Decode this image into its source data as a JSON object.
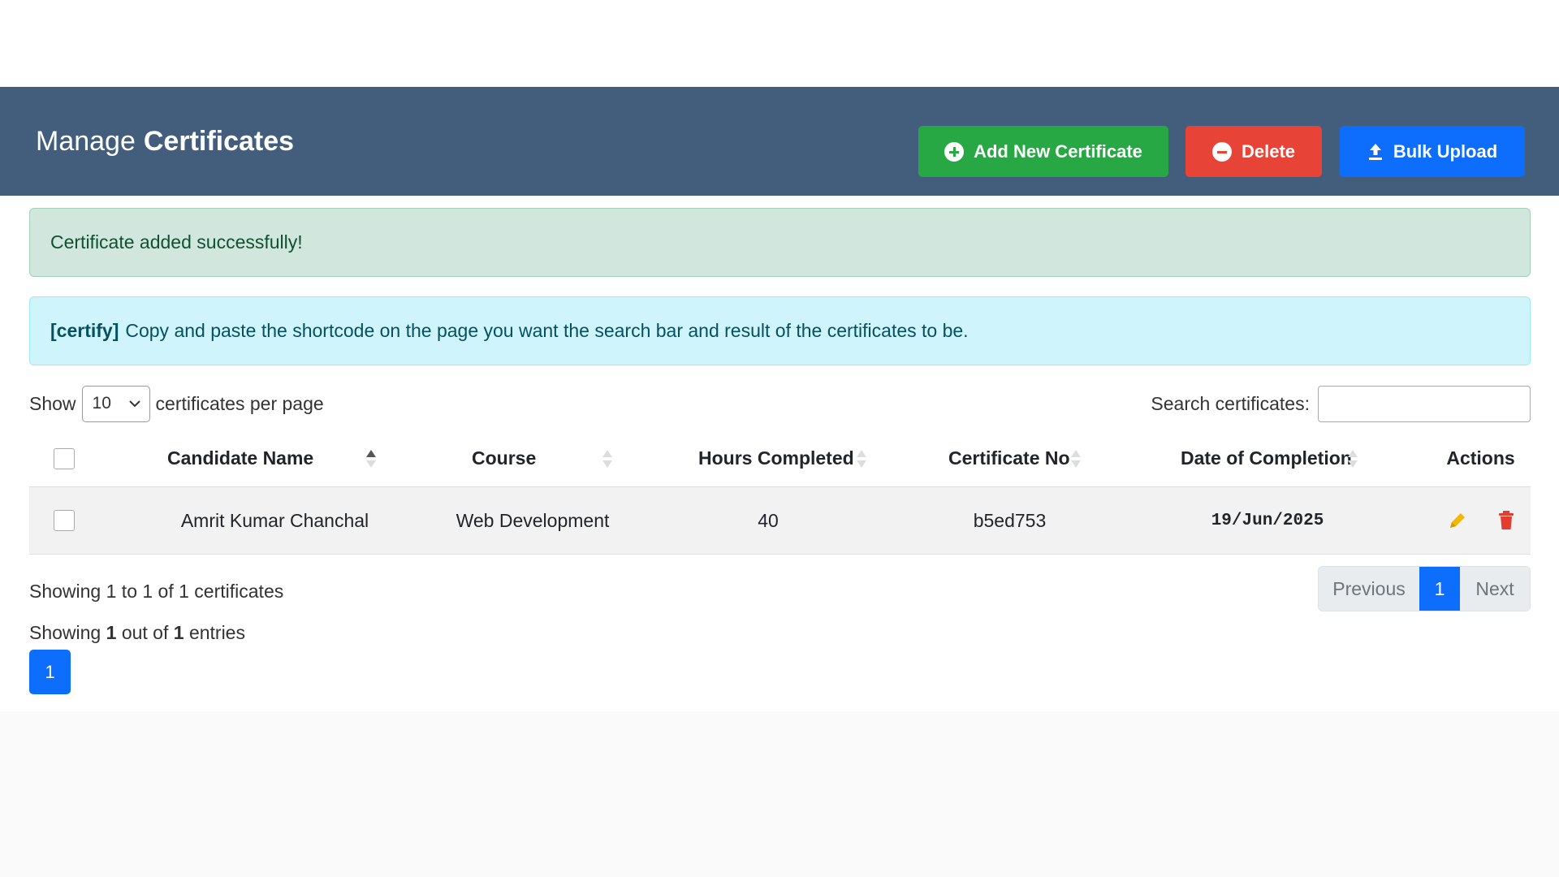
{
  "header": {
    "title_prefix": "Manage",
    "title_bold": "Certificates",
    "buttons": {
      "add": "Add New Certificate",
      "delete": "Delete",
      "bulk": "Bulk Upload"
    },
    "background_color": "#435e7c"
  },
  "alerts": {
    "success": "Certificate added successfully!",
    "info_code": "[certify]",
    "info_text": "Copy and paste the shortcode on the page you want the search bar and result of the certificates to be."
  },
  "controls": {
    "show_label": "Show",
    "page_size": "10",
    "per_page_label": "certificates per page",
    "search_label": "Search certificates:",
    "search_value": ""
  },
  "table": {
    "headers": [
      "Candidate Name",
      "Course",
      "Hours Completed",
      "Certificate No",
      "Date of Completion",
      "Actions"
    ],
    "rows": [
      {
        "candidate": "Amrit Kumar Chanchal",
        "course": "Web Development",
        "hours": "40",
        "certificate_no": "b5ed753",
        "date": "19/Jun/2025",
        "actions": [
          "edit-icon",
          "trash-icon"
        ]
      }
    ]
  },
  "footer": {
    "info": "Showing 1 to 1 of 1 certificates",
    "pager": {
      "previous": "Previous",
      "current": "1",
      "next": "Next"
    },
    "entries_prefix": "Showing",
    "entries_shown": "1",
    "entries_mid": "out of",
    "entries_total": "1",
    "entries_suffix": "entries",
    "page_button": "1"
  },
  "colors": {
    "success": "#28a745",
    "danger": "#e84337",
    "primary": "#0d6efd",
    "edit": "#f5b800"
  }
}
